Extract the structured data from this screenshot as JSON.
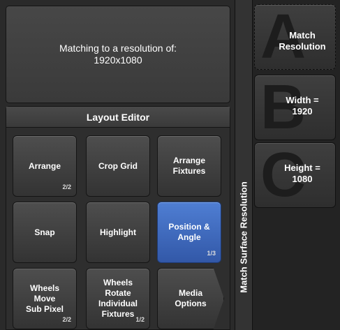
{
  "message": {
    "line1": "Matching to a resolution of:",
    "line2": "1920x1080"
  },
  "layout_editor": {
    "title": "Layout Editor",
    "buttons": [
      {
        "label": "Arrange",
        "page": "2/2"
      },
      {
        "label": "Crop Grid",
        "page": ""
      },
      {
        "label": "Arrange\nFixtures",
        "page": ""
      },
      {
        "label": "Snap",
        "page": ""
      },
      {
        "label": "Highlight",
        "page": ""
      },
      {
        "label": "Position &\nAngle",
        "page": "1/3"
      },
      {
        "label": "Wheels\nMove\nSub Pixel",
        "page": "2/2"
      },
      {
        "label": "Wheels\nRotate\nIndividual\nFixtures",
        "page": "1/2"
      },
      {
        "label": "Media\nOptions",
        "page": ""
      }
    ]
  },
  "vertical_title": "Match Surface Resolution",
  "side_buttons": [
    {
      "letter": "A",
      "label": "Match\nResolution"
    },
    {
      "letter": "B",
      "label": "Width =\n1920"
    },
    {
      "letter": "C",
      "label": "Height =\n1080"
    }
  ],
  "colors": {
    "active_button": "#3f6cc4",
    "background": "#1c1c1c"
  }
}
